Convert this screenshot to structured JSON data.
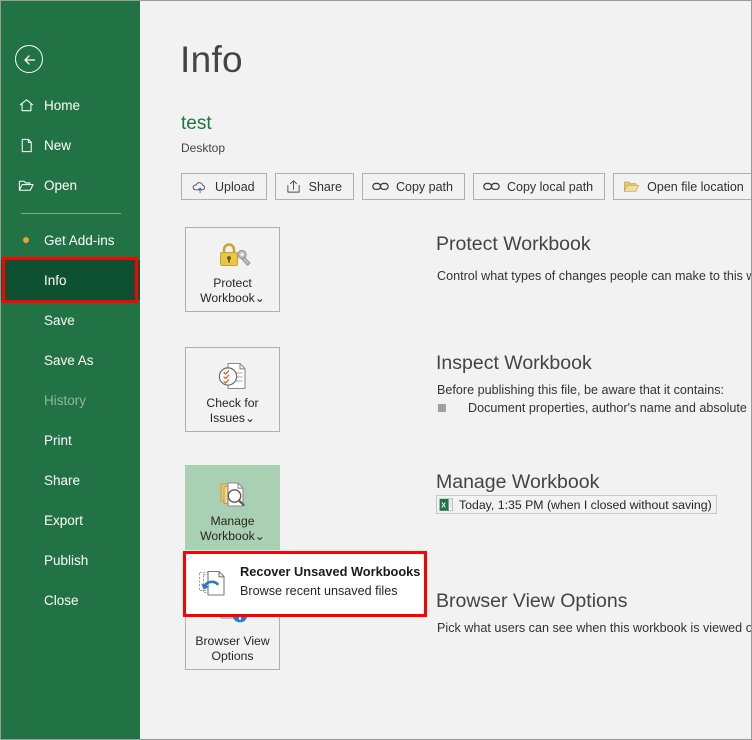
{
  "sidebar": {
    "back_label": "Back",
    "items": [
      {
        "label": "Home",
        "icon": "home-icon",
        "state": "normal"
      },
      {
        "label": "New",
        "icon": "page-icon",
        "state": "normal"
      },
      {
        "label": "Open",
        "icon": "folder-icon",
        "state": "normal"
      },
      {
        "label": "Get Add-ins",
        "icon": "dot-icon",
        "state": "normal"
      },
      {
        "label": "Info",
        "icon": "none",
        "state": "selected"
      },
      {
        "label": "Save",
        "icon": "none",
        "state": "normal"
      },
      {
        "label": "Save As",
        "icon": "none",
        "state": "normal"
      },
      {
        "label": "History",
        "icon": "none",
        "state": "disabled"
      },
      {
        "label": "Print",
        "icon": "none",
        "state": "normal"
      },
      {
        "label": "Share",
        "icon": "none",
        "state": "normal"
      },
      {
        "label": "Export",
        "icon": "none",
        "state": "normal"
      },
      {
        "label": "Publish",
        "icon": "none",
        "state": "normal"
      },
      {
        "label": "Close",
        "icon": "none",
        "state": "normal"
      }
    ]
  },
  "main": {
    "page_title": "Info",
    "file_name": "test",
    "file_path": "Desktop",
    "toolbar": [
      {
        "label": "Upload",
        "icon": "cloud-upload-icon"
      },
      {
        "label": "Share",
        "icon": "share-arrow-icon"
      },
      {
        "label": "Copy path",
        "icon": "link-icon"
      },
      {
        "label": "Copy local path",
        "icon": "link-icon"
      },
      {
        "label": "Open file location",
        "icon": "folder-open-icon"
      }
    ],
    "sections": {
      "protect": {
        "button_line1": "Protect",
        "button_line2": "Workbook",
        "button_chevron": "⌄",
        "title": "Protect Workbook",
        "description": "Control what types of changes people can make to this workbook."
      },
      "inspect": {
        "button_line1": "Check for",
        "button_line2": "Issues",
        "button_chevron": "⌄",
        "title": "Inspect Workbook",
        "description": "Before publishing this file, be aware that it contains:",
        "bullets": [
          "Document properties, author's name and absolute path"
        ]
      },
      "manage": {
        "button_line1": "Manage",
        "button_line2": "Workbook",
        "button_chevron": "⌄",
        "title": "Manage Workbook",
        "version_entry": "Today, 1:35 PM (when I closed without saving)"
      },
      "browser_view": {
        "button_line1": "Browser View",
        "button_line2": "Options",
        "title": "Browser View Options",
        "description": "Pick what users can see when this workbook is viewed on the Web."
      }
    },
    "popup": {
      "title": "Recover Unsaved Workbooks",
      "description": "Browse recent unsaved files",
      "icon": "recover-document-icon"
    }
  },
  "colors": {
    "sidebar_green": "#217346",
    "sidebar_selected": "#0e5132",
    "highlight_red": "#ff0000",
    "hover_green": "#a9d0b3",
    "accent_orange": "#eda42b",
    "background": "#f2f2f2"
  }
}
